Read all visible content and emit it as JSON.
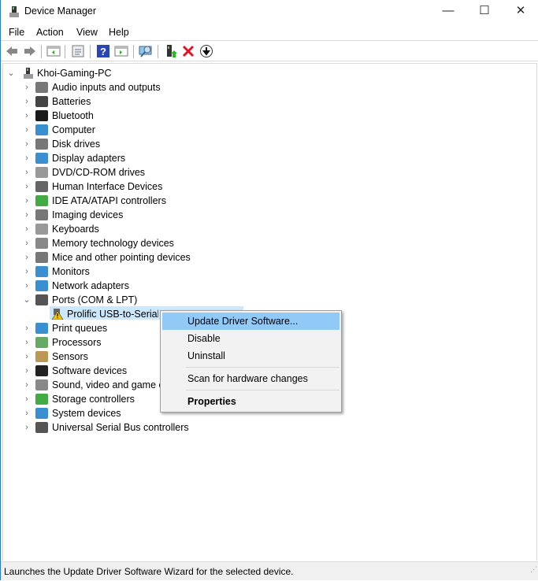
{
  "window": {
    "title": "Device Manager",
    "minimize": "—",
    "maximize": "☐",
    "close": "✕"
  },
  "menu": [
    "File",
    "Action",
    "View",
    "Help"
  ],
  "toolbar": [
    "back-icon",
    "forward-icon",
    "show-hide-console-tree-icon",
    "properties-icon",
    "help-icon",
    "action-pane-icon",
    "scan-hardware-icon",
    "update-driver-icon",
    "uninstall-icon",
    "disable-icon"
  ],
  "tree": {
    "root": "Khoi-Gaming-PC",
    "categories": [
      "Audio inputs and outputs",
      "Batteries",
      "Bluetooth",
      "Computer",
      "Disk drives",
      "Display adapters",
      "DVD/CD-ROM drives",
      "Human Interface Devices",
      "IDE ATA/ATAPI controllers",
      "Imaging devices",
      "Keyboards",
      "Memory technology devices",
      "Mice and other pointing devices",
      "Monitors",
      "Network adapters",
      "Ports (COM & LPT)",
      "Print queues",
      "Processors",
      "Sensors",
      "Software devices",
      "Sound, video and game controllers",
      "Storage controllers",
      "System devices",
      "Universal Serial Bus controllers"
    ],
    "expanded_child": "Prolific USB-to-Serial Comm Port"
  },
  "context_menu": {
    "items": [
      "Update Driver Software...",
      "Disable",
      "Uninstall",
      "Scan for hardware changes",
      "Properties"
    ]
  },
  "status": "Launches the Update Driver Software Wizard for the selected device.",
  "colors": {
    "selection": "#cce8ff",
    "menu_highlight": "#91c9f7",
    "warning": "#f5c400",
    "delete": "#e81123"
  }
}
